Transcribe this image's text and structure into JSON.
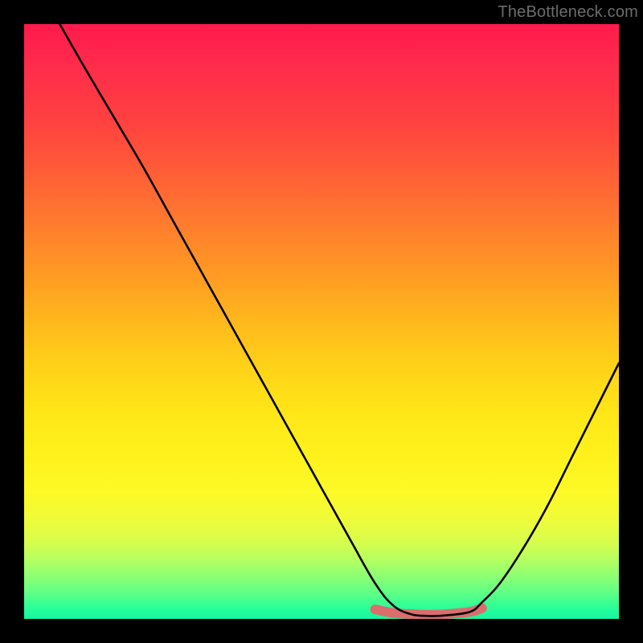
{
  "watermark": "TheBottleneck.com",
  "chart_data": {
    "type": "line",
    "title": "",
    "xlabel": "",
    "ylabel": "",
    "xlim": [
      0,
      100
    ],
    "ylim": [
      0,
      100
    ],
    "series": [
      {
        "name": "curve",
        "x": [
          6,
          10,
          15,
          20,
          25,
          30,
          35,
          40,
          45,
          50,
          55,
          59,
          62,
          65,
          68,
          71,
          75,
          77,
          80,
          84,
          88,
          92,
          96,
          100
        ],
        "values": [
          100,
          93,
          84.5,
          76,
          67,
          58,
          49,
          40,
          31,
          22,
          13,
          6,
          2.3,
          0.8,
          0.5,
          0.6,
          1.2,
          2.8,
          6,
          12,
          19,
          27,
          35,
          43
        ]
      },
      {
        "name": "highlight-band",
        "x": [
          59,
          62,
          65,
          68,
          71,
          75,
          77
        ],
        "values": [
          1.6,
          1.0,
          0.8,
          0.7,
          0.8,
          1.2,
          1.8
        ]
      }
    ],
    "colors": {
      "curve": "#000000",
      "highlight": "#db6d6d",
      "gradient_top": "#ff1a4d",
      "gradient_bottom": "#14f7a2"
    }
  }
}
